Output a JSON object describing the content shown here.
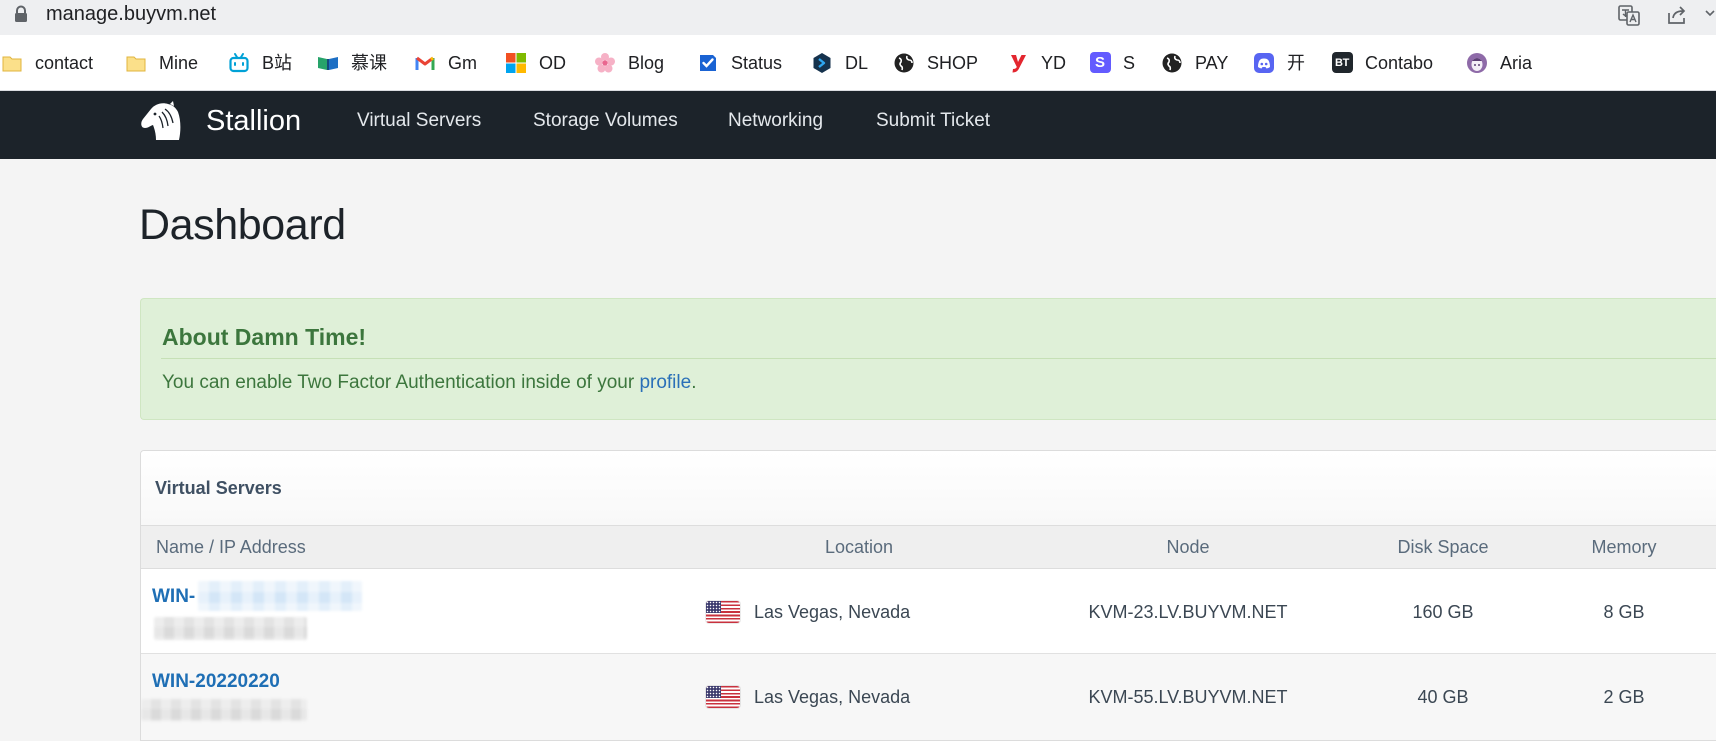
{
  "browser": {
    "url": "manage.buyvm.net",
    "lock_icon": "lock-icon",
    "translate_icon": "translate-icon",
    "share_icon": "share-icon",
    "menu_icon": "chevron-down-icon"
  },
  "bookmarks": [
    {
      "label": "contact",
      "icon": "folder-icon"
    },
    {
      "label": "Mine",
      "icon": "folder-icon"
    },
    {
      "label": "B站",
      "icon": "bilibili-icon"
    },
    {
      "label": "慕课",
      "icon": "book-icon"
    },
    {
      "label": "Gm",
      "icon": "gmail-icon"
    },
    {
      "label": "OD",
      "icon": "microsoft-icon"
    },
    {
      "label": "Blog",
      "icon": "flower-icon"
    },
    {
      "label": "Status",
      "icon": "checkbox-icon"
    },
    {
      "label": "DL",
      "icon": "hexagon-icon"
    },
    {
      "label": "SHOP",
      "icon": "globe-icon"
    },
    {
      "label": "YD",
      "icon": "y-logo-icon"
    },
    {
      "label": "S",
      "icon": "s-logo-icon",
      "icon_text": "S"
    },
    {
      "label": "PAY",
      "icon": "globe-icon"
    },
    {
      "label": "开",
      "icon": "discord-icon"
    },
    {
      "label": "Contabo",
      "icon": "bt-logo-icon",
      "icon_text": "BT"
    },
    {
      "label": "Aria",
      "icon": "aria-icon"
    }
  ],
  "nav": {
    "logo_icon": "horse-head-icon",
    "brand": "Stallion",
    "links": [
      "Virtual Servers",
      "Storage Volumes",
      "Networking",
      "Submit Ticket"
    ]
  },
  "page": {
    "title": "Dashboard"
  },
  "alert": {
    "heading": "About Damn Time!",
    "text": "You can enable Two Factor Authentication inside of your ",
    "link": "profile",
    "suffix": "."
  },
  "servers_panel": {
    "title": "Virtual Servers",
    "columns": [
      "Name / IP Address",
      "Location",
      "Node",
      "Disk Space",
      "Memory"
    ],
    "rows": [
      {
        "name": "WIN-",
        "flag_icon": "us-flag-icon",
        "location": "Las Vegas, Nevada",
        "node": "KVM-23.LV.BUYVM.NET",
        "disk": "160 GB",
        "memory": "8 GB"
      },
      {
        "name": "WIN-20220220",
        "flag_icon": "us-flag-icon",
        "location": "Las Vegas, Nevada",
        "node": "KVM-55.LV.BUYVM.NET",
        "disk": "40 GB",
        "memory": "2 GB"
      }
    ]
  },
  "colors": {
    "nav_bg": "#1c232a",
    "page_bg": "#f4f4f4",
    "alert_bg": "#dff0d8",
    "alert_text": "#3c763d",
    "link": "#2a70b8"
  }
}
